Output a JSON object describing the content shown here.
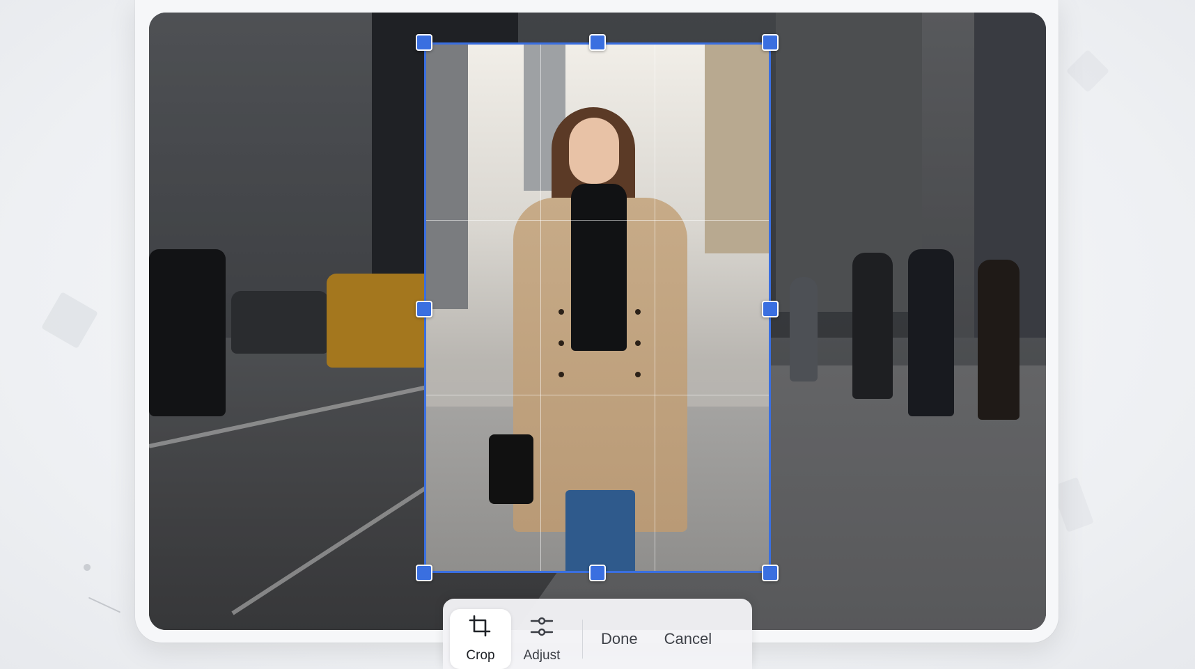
{
  "toolbar": {
    "crop_label": "Crop",
    "adjust_label": "Adjust",
    "done_label": "Done",
    "cancel_label": "Cancel",
    "active_tool": "crop"
  },
  "icons": {
    "crop": "crop-icon",
    "adjust": "sliders-icon"
  },
  "colors": {
    "accent": "#3a6fe0",
    "handle_border": "#ffffff"
  }
}
